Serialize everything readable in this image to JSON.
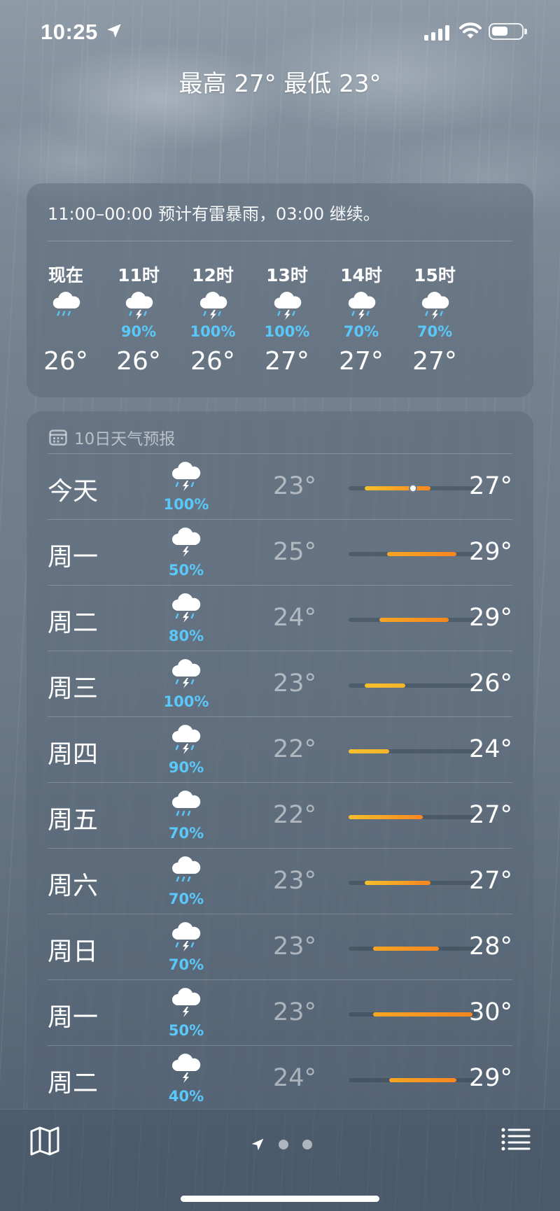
{
  "status_bar": {
    "time": "10:25",
    "battery_level": 0.55
  },
  "header": {
    "hi_lo": "最高 27°  最低 23°"
  },
  "hourly": {
    "summary": "11:00–00:00 预计有雷暴雨，03:00 继续。",
    "items": [
      {
        "label": "现在",
        "icon": "rain-cloud-icon",
        "precip": "",
        "temp": "26°"
      },
      {
        "label": "11时",
        "icon": "thunderstorm-icon",
        "precip": "90%",
        "temp": "26°"
      },
      {
        "label": "12时",
        "icon": "thunderstorm-icon",
        "precip": "100%",
        "temp": "26°"
      },
      {
        "label": "13时",
        "icon": "thunderstorm-icon",
        "precip": "100%",
        "temp": "27°"
      },
      {
        "label": "14时",
        "icon": "thunderstorm-icon",
        "precip": "70%",
        "temp": "27°"
      },
      {
        "label": "15时",
        "icon": "thunderstorm-icon",
        "precip": "70%",
        "temp": "27°"
      }
    ]
  },
  "daily": {
    "title": "10日天气预报",
    "range_min": 22,
    "range_max": 30,
    "current_temp": 26,
    "days": [
      {
        "name": "今天",
        "icon": "thunderstorm-icon",
        "precip": "100%",
        "low": "23°",
        "high": "27°",
        "low_val": 23,
        "high_val": 27.1
      },
      {
        "name": "周一",
        "icon": "lightning-cloud-icon",
        "precip": "50%",
        "low": "25°",
        "high": "29°",
        "low_val": 24.4,
        "high_val": 28.7
      },
      {
        "name": "周二",
        "icon": "thunderstorm-icon",
        "precip": "80%",
        "low": "24°",
        "high": "29°",
        "low_val": 23.9,
        "high_val": 28.2
      },
      {
        "name": "周三",
        "icon": "thunderstorm-icon",
        "precip": "100%",
        "low": "23°",
        "high": "26°",
        "low_val": 23.0,
        "high_val": 25.5
      },
      {
        "name": "周四",
        "icon": "thunderstorm-icon",
        "precip": "90%",
        "low": "22°",
        "high": "24°",
        "low_val": 22.0,
        "high_val": 24.5
      },
      {
        "name": "周五",
        "icon": "rain-cloud-icon",
        "precip": "70%",
        "low": "22°",
        "high": "27°",
        "low_val": 22.0,
        "high_val": 26.6
      },
      {
        "name": "周六",
        "icon": "rain-cloud-icon",
        "precip": "70%",
        "low": "23°",
        "high": "27°",
        "low_val": 23.0,
        "high_val": 27.1
      },
      {
        "name": "周日",
        "icon": "thunderstorm-icon",
        "precip": "70%",
        "low": "23°",
        "high": "28°",
        "low_val": 23.5,
        "high_val": 27.6
      },
      {
        "name": "周一",
        "icon": "lightning-cloud-icon",
        "precip": "50%",
        "low": "23°",
        "high": "30°",
        "low_val": 23.5,
        "high_val": 29.7
      },
      {
        "name": "周二",
        "icon": "lightning-cloud-icon",
        "precip": "40%",
        "low": "24°",
        "high": "29°",
        "low_val": 24.5,
        "high_val": 28.7
      }
    ]
  },
  "colors": {
    "precip_blue": "#5ac8fa",
    "bar_yellow": "#f6c02b",
    "bar_orange": "#f7861f"
  },
  "toolbar": {
    "page_count": 3
  }
}
